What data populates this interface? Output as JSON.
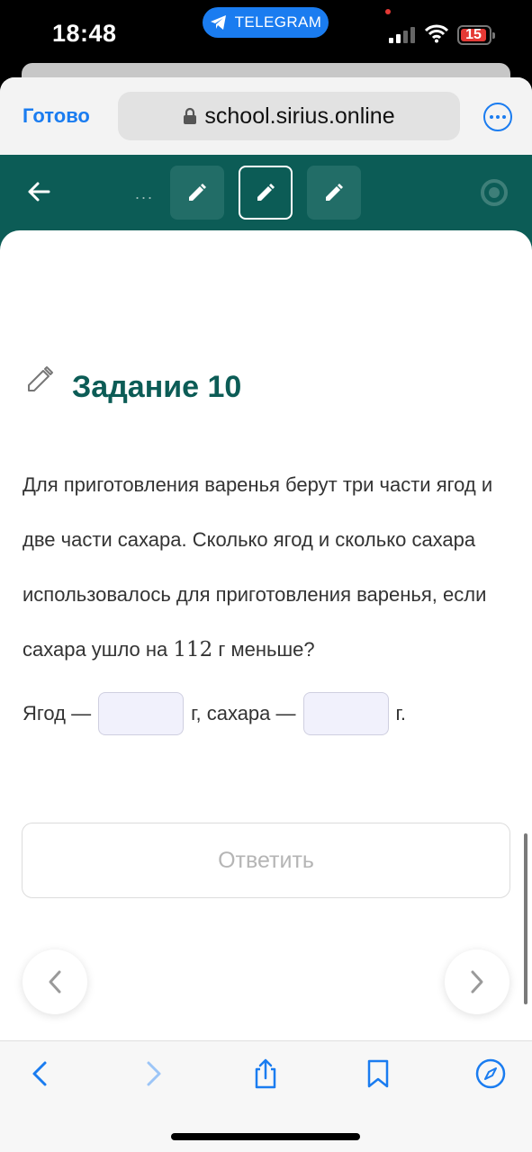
{
  "status": {
    "time": "18:48",
    "pill_label": "TELEGRAM",
    "battery": "15",
    "battery_color": "#e53935"
  },
  "browser": {
    "done_label": "Готово",
    "url": "school.sirius.online",
    "accent_color": "#1a7cf0"
  },
  "header": {
    "back_icon": "arrow-left-icon",
    "more_tasks": "...",
    "task_icons": [
      "pencil-icon",
      "pencil-icon",
      "pencil-icon"
    ],
    "active_task_index": 1,
    "progress_icon": "progress-ring-icon",
    "background_color": "#0c5c56"
  },
  "task": {
    "title": "Задание 10",
    "text_before_number": "Для приготовления варенья берут три части ягод и две части сахара. Сколько ягод и сколько сахара использовалось для приготовления варенья, если сахара ушло на ",
    "number": "112",
    "text_after_number": " г меньше?",
    "answer_prefix": "Ягод —",
    "answer_middle": "г, сахара —",
    "answer_suffix": "г.",
    "berries_value": "",
    "sugar_value": "",
    "submit_label": "Ответить"
  },
  "toolbar": {
    "icons": [
      "back-icon",
      "forward-icon",
      "share-icon",
      "bookmarks-icon",
      "compass-icon"
    ]
  }
}
